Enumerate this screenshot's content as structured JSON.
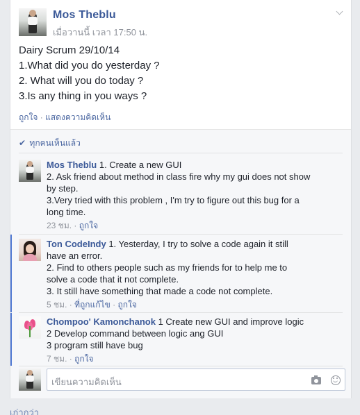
{
  "post": {
    "author": "Mos Theblu",
    "time": "เมื่อวานนี้ เวลา 17:50 น.",
    "lines": [
      "Dairy Scrum 29/10/14",
      "1.What did you do yesterday ?",
      "2. What will you do today ?",
      "3.Is any thing in you ways ?"
    ],
    "like_label": "ถูกใจ",
    "comment_label": "แสดงความคิดเห็น",
    "separator": "·"
  },
  "seen": {
    "label": "ทุกคนเห็นแล้ว"
  },
  "comments": [
    {
      "name": "Mos Theblu",
      "lines": [
        "1. Create a new GUI",
        "2. Ask friend about method in class fire why my gui does not show",
        "by step.",
        "3.Very tried with this problem , I'm try to figure out this bug for a",
        "long time."
      ],
      "time": "23 ชม.",
      "like": "ถูกใจ",
      "edited": ""
    },
    {
      "name": "Ton CodeIndy",
      "lines": [
        "1. Yesterday, I try to solve a code again it still",
        "have an error.",
        "2. Find to others people such as my friends for to help me to",
        "solve a code that it not complete.",
        "3. It still have something that made a code not complete."
      ],
      "time": "5 ชม.",
      "like": "ถูกใจ",
      "edited": "ที่ถูกแก้ไข"
    },
    {
      "name": "Chompoo' Kamonchanok",
      "lines": [
        "1 Create new GUI and improve logic",
        "2 Develop command between logic ang GUI",
        "3 program still have bug"
      ],
      "time": "7 ชม.",
      "like": "ถูกใจ",
      "edited": ""
    }
  ],
  "composer": {
    "placeholder": "เขียนความคิดเห็น"
  },
  "older_link": "เก่ากว่า",
  "colors": {
    "link": "#3b5998",
    "thread_bar": "#4f78d2",
    "background": "#e9ebee"
  }
}
